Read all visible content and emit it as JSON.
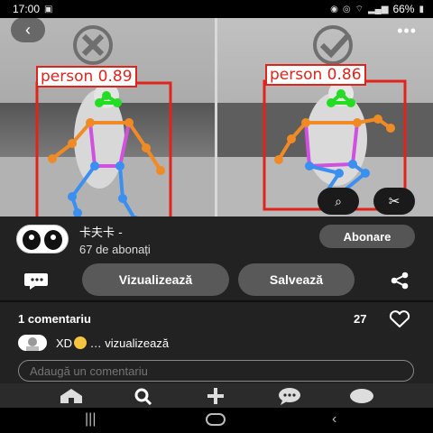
{
  "status_bar": {
    "time": "17:00",
    "battery": "66%"
  },
  "media": {
    "left_detection": {
      "label": "person 0.89"
    },
    "right_detection": {
      "label": "person 0.86"
    },
    "icons": [
      "back-icon",
      "more-icon",
      "cross-icon",
      "check-icon",
      "lens-icon",
      "scissors-icon"
    ]
  },
  "author": {
    "name": "卡夫卡 -",
    "subscribers": "67 de abonați",
    "follow_label": "Abonare"
  },
  "actions": {
    "view_label": "Vizualizează",
    "save_label": "Salvează"
  },
  "comments": {
    "count_label": "1 comentariu",
    "likes": "27",
    "first": {
      "text": "XD",
      "suffix": " … vizualizează"
    },
    "input_placeholder": "Adaugă un comentariu"
  },
  "app_nav": {
    "items": [
      "home-icon",
      "search-icon",
      "plus-icon",
      "messages-icon",
      "profile-icon"
    ]
  },
  "colors": {
    "detection_box": "#e0241b",
    "keypoint_head": "#22dd22",
    "keypoint_arms": "#f08a24",
    "keypoint_torso": "#d050e0",
    "keypoint_legs": "#3a8ff0"
  }
}
